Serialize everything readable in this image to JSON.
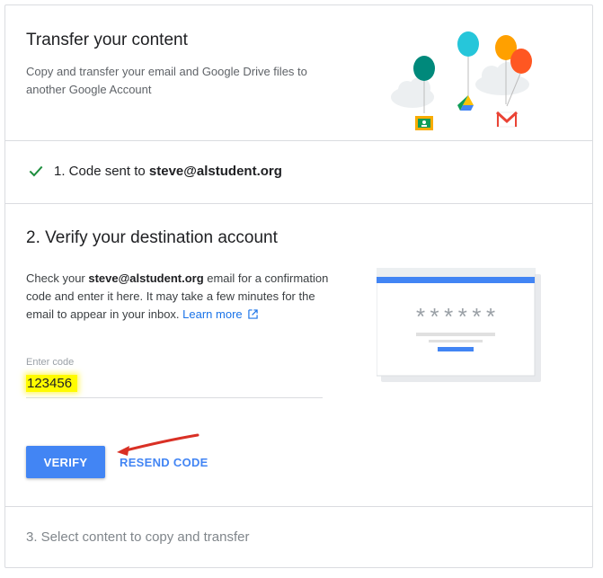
{
  "header": {
    "title": "Transfer your content",
    "description": "Copy and transfer your email and Google Drive files to another Google Account"
  },
  "step1": {
    "prefix": "1. Code sent to ",
    "email": "steve@alstudent.org"
  },
  "step2": {
    "title": "2. Verify your destination account",
    "text_before": "Check your ",
    "email": "steve@alstudent.org",
    "text_after": " email for a confirmation code and enter it here. It may take a few minutes for the email to appear in your inbox. ",
    "link_label": "Learn more",
    "field_label": "Enter code",
    "field_value": "123456",
    "verify_label": "VERIFY",
    "resend_label": "RESEND CODE",
    "masked_code": "******"
  },
  "step3": {
    "label": "3. Select content to copy and transfer"
  },
  "colors": {
    "primary": "#4285f4",
    "check": "#1e8e3e",
    "highlight": "#fffb00",
    "arrow": "#d93025"
  },
  "icons": {
    "check": "check-icon",
    "external": "external-link-icon",
    "annotation": "red-arrow"
  }
}
